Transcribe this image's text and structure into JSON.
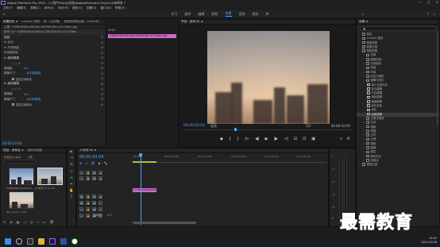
{
  "window": {
    "title": "Adobe Premiere Pro 2020 - C:\\用户\\Fishy\\文档\\Adobe\\Premiere Pro\\14.0\\未命名 *",
    "controls": [
      "—",
      "□",
      "✕"
    ]
  },
  "menu": [
    "文件(F)",
    "编辑(E)",
    "剪辑(C)",
    "序列(S)",
    "标记(M)",
    "图形(G)",
    "视图(V)",
    "窗口(W)",
    "帮助(H)"
  ],
  "workspaces": {
    "items": [
      "学习",
      "组件",
      "编辑",
      "颜色",
      "效果",
      "音频",
      "图形",
      "库"
    ],
    "active_index": 4,
    "more": "»"
  },
  "effect_controls": {
    "tabs": [
      "效果控件 ≡",
      "Lumetri 范围",
      "源：(无剪辑)",
      "音频剪辑混合器：1905061"
    ],
    "master_row": "主要 * 04B9D9B2A5634AC3B3F8036110170b6c.jpg",
    "seq_row": "序列 01 * 04B9D9B2A5634AC3B3F8036110170b6c...",
    "timeline_clip": "04B9D9B2A5634AC3B3F8036110170b6c.jpg",
    "timeline_time": "00:00",
    "rows": [
      {
        "label": "视频",
        "kind": "head"
      },
      {
        "label": "fx  运动",
        "kind": "item"
      },
      {
        "label": "fx  不透明度",
        "kind": "item"
      },
      {
        "label": "  时间重映射",
        "kind": "item"
      },
      {
        "label": "fx  高斯模糊",
        "kind": "head"
      },
      {
        "label": "○ □ ✎",
        "kind": "small"
      },
      {
        "label": "模糊度",
        "value": "0.0",
        "kind": "item"
      },
      {
        "label": "模糊尺寸",
        "value": "水平和垂直",
        "kind": "item"
      },
      {
        "label": "",
        "check": "重复边缘像素",
        "kind": "small"
      },
      {
        "label": "fx  高斯模糊",
        "kind": "head"
      },
      {
        "label": "○ □ ✎",
        "kind": "small"
      },
      {
        "label": "模糊度",
        "value": "0.0",
        "kind": "item"
      },
      {
        "label": "模糊尺寸",
        "value": "水平和垂直",
        "kind": "item"
      },
      {
        "label": "",
        "check": "重复边缘像素",
        "kind": "small"
      }
    ],
    "timecode": "00:00:03:04"
  },
  "program_monitor": {
    "tab": "节目：序列 01 ≡",
    "timecode": "00:00:03:04",
    "fit": "适合",
    "fraction": "1/2",
    "duration": "00:00:10:00",
    "transport": [
      "◆",
      "{",
      "}",
      "|←",
      "◀|",
      "▶",
      "|▶",
      "→|",
      "⊟",
      "⊡",
      "▣"
    ],
    "right_buttons": [
      "+",
      "⚙"
    ],
    "playhead_fraction": 0.31
  },
  "effects_panel": {
    "tab": "效果 ≡",
    "search_placeholder": "🔍",
    "items": [
      {
        "label": "预设",
        "level": 0,
        "fold": "›"
      },
      {
        "label": "Lumetri 预设",
        "level": 0,
        "fold": "›"
      },
      {
        "label": "音频效果",
        "level": 0,
        "fold": "›"
      },
      {
        "label": "音频过渡",
        "level": 0,
        "fold": "›"
      },
      {
        "label": "视频效果",
        "level": 0,
        "fold": "⌄"
      },
      {
        "label": "变换",
        "level": 1,
        "fold": "›"
      },
      {
        "label": "图像控制",
        "level": 1,
        "fold": "›"
      },
      {
        "label": "实用程序",
        "level": 1,
        "fold": "›"
      },
      {
        "label": "扭曲",
        "level": 1,
        "fold": "›"
      },
      {
        "label": "时间",
        "level": 1,
        "fold": "›"
      },
      {
        "label": "杂色与颗粒",
        "level": 1,
        "fold": "›"
      },
      {
        "label": "模糊与锐化",
        "level": 1,
        "fold": "⌄"
      },
      {
        "label": "减少交错闪烁",
        "level": 2,
        "fx": true
      },
      {
        "label": "复合模糊",
        "level": 2,
        "fx": true
      },
      {
        "label": "方向模糊",
        "level": 2,
        "fx": true
      },
      {
        "label": "相机模糊",
        "level": 2,
        "fx": true
      },
      {
        "label": "通道模糊",
        "level": 2,
        "fx": true
      },
      {
        "label": "钝化蒙版",
        "level": 2,
        "fx": true
      },
      {
        "label": "锐化",
        "level": 2,
        "fx": true
      },
      {
        "label": "高斯模糊",
        "level": 2,
        "fx": true,
        "selected": true
      },
      {
        "label": "沉浸式视频",
        "level": 1,
        "fold": "›"
      },
      {
        "label": "生成",
        "level": 1,
        "fold": "›"
      },
      {
        "label": "视频",
        "level": 1,
        "fold": "›"
      },
      {
        "label": "调整",
        "level": 1,
        "fold": "›"
      },
      {
        "label": "过时",
        "level": 1,
        "fold": "›"
      },
      {
        "label": "过渡",
        "level": 1,
        "fold": "›"
      },
      {
        "label": "透视",
        "level": 1,
        "fold": "›"
      },
      {
        "label": "通道",
        "level": 1,
        "fold": "›"
      },
      {
        "label": "键控",
        "level": 1,
        "fold": "›"
      },
      {
        "label": "颜色校正",
        "level": 1,
        "fold": "›"
      },
      {
        "label": "风格化",
        "level": 1,
        "fold": "›"
      },
      {
        "label": "视频过渡",
        "level": 0,
        "fold": "›"
      }
    ]
  },
  "project": {
    "tabs": [
      "项目：未命名 ≡",
      "媒体浏览器"
    ],
    "path": "未命名.prproj",
    "item_count": "3项",
    "items": [
      {
        "name": "04B9D9B2A5634AC3...",
        "duration": "5:00"
      },
      {
        "name": "序列 01",
        "duration": "10:00"
      },
      {
        "name": "IMG_2020...",
        "duration": "5:00"
      }
    ],
    "bottom_icons": [
      "✎",
      "≣",
      "▦",
      "○",
      "◎",
      "⌕",
      "▭",
      "🗑"
    ]
  },
  "tools": [
    "▶",
    "⇥",
    "⇆",
    "◇",
    "↔",
    "✒",
    "✋",
    "T"
  ],
  "timeline": {
    "tab": "✕ 序列 01 ≡",
    "timecode": "00:00:03:04",
    "ruler": [
      ":00:00",
      "00:00:05:00",
      "00:00:10:00",
      "00:00:15:00",
      "00:00:20:00",
      "00:00:25:00"
    ],
    "tracks": [
      {
        "name": "V3",
        "y": 20
      },
      {
        "name": "V2",
        "y": 27
      },
      {
        "name": "V1",
        "y": 50
      },
      {
        "name": "A1",
        "y": 58
      },
      {
        "name": "A2",
        "y": 66
      },
      {
        "name": "A3",
        "y": 74
      }
    ],
    "clip": "fx 04B9D9B2A5634AC3B3",
    "master": {
      "label": "主声道",
      "value": "0.0"
    }
  },
  "audio_meter": {
    "scale": [
      "0",
      "-12",
      "-24",
      "-36",
      "-48",
      "dB"
    ],
    "solo": [
      "S",
      "S"
    ]
  },
  "taskbar": {
    "time": "15:42",
    "date": "2021/11/18",
    "lang": "中"
  },
  "watermark": "最需教育",
  "colors": {
    "accent": "#4ea3ff",
    "clip": "#d068cf",
    "panel": "#232323",
    "watermark": "#2b6de0"
  }
}
